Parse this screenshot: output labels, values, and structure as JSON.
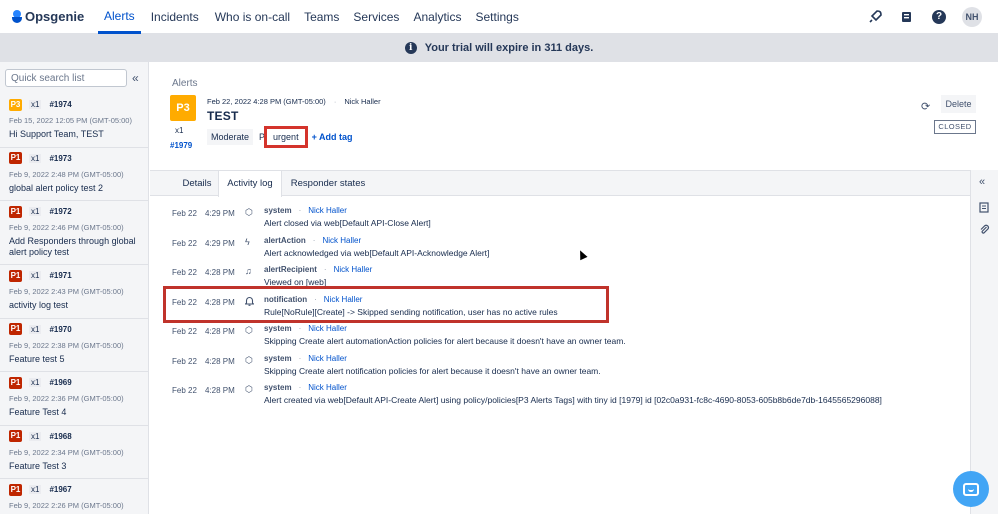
{
  "app": {
    "name": "Opsgenie"
  },
  "nav": {
    "items": [
      {
        "label": "Alerts",
        "active": true
      },
      {
        "label": "Incidents"
      },
      {
        "label": "Who is on-call"
      },
      {
        "label": "Teams"
      },
      {
        "label": "Services"
      },
      {
        "label": "Analytics"
      },
      {
        "label": "Settings"
      }
    ],
    "avatar_initials": "NH",
    "help_glyph": "?"
  },
  "banner": {
    "text": "Your trial will expire in 311 days.",
    "info_glyph": "i"
  },
  "sidebar": {
    "search_placeholder": "Quick search list",
    "collapse_glyph": "«",
    "alerts": [
      {
        "priority": "P3",
        "count": "x1",
        "tiny_id": "#1974",
        "date": "Feb 15, 2022 12:05 PM (GMT-05:00)",
        "message": "Hi Support Team, TEST"
      },
      {
        "priority": "P1",
        "count": "x1",
        "tiny_id": "#1973",
        "date": "Feb 9, 2022 2:48 PM (GMT-05:00)",
        "message": "global alert policy test 2"
      },
      {
        "priority": "P1",
        "count": "x1",
        "tiny_id": "#1972",
        "date": "Feb 9, 2022 2:46 PM (GMT-05:00)",
        "message": "Add Responders through global alert policy test"
      },
      {
        "priority": "P1",
        "count": "x1",
        "tiny_id": "#1971",
        "date": "Feb 9, 2022 2:43 PM (GMT-05:00)",
        "message": "activity log test"
      },
      {
        "priority": "P1",
        "count": "x1",
        "tiny_id": "#1970",
        "date": "Feb 9, 2022 2:38 PM (GMT-05:00)",
        "message": "Feature test 5"
      },
      {
        "priority": "P1",
        "count": "x1",
        "tiny_id": "#1969",
        "date": "Feb 9, 2022 2:36 PM (GMT-05:00)",
        "message": "Feature Test 4"
      },
      {
        "priority": "P1",
        "count": "x1",
        "tiny_id": "#1968",
        "date": "Feb 9, 2022 2:34 PM (GMT-05:00)",
        "message": "Feature Test 3"
      },
      {
        "priority": "P1",
        "count": "x1",
        "tiny_id": "#1967",
        "date": "Feb 9, 2022 2:26 PM (GMT-05:00)",
        "message": ""
      }
    ]
  },
  "detail": {
    "breadcrumb": "Alerts",
    "priority": "P3",
    "count": "x1",
    "tiny_id": "#1979",
    "created": "Feb 22, 2022 4:28 PM (GMT-05:00)",
    "separator": "·",
    "owner": "Nick Haller",
    "title": "TEST",
    "tags": {
      "moderate": "Moderate",
      "p_prefix": "P",
      "urgent": "urgent",
      "add_tag": "+ Add tag"
    },
    "refresh_glyph": "⟳",
    "delete_label": "Delete",
    "status": "CLOSED",
    "tabs": [
      {
        "label": "Details"
      },
      {
        "label": "Activity log",
        "active": true
      },
      {
        "label": "Responder states"
      }
    ]
  },
  "activity_log": [
    {
      "date": "Feb 22",
      "time": "4:29 PM",
      "icon": "cube-icon",
      "glyph": "⬡",
      "actor": "system",
      "user": "Nick Haller",
      "message": "Alert closed via web[Default API-Close Alert]"
    },
    {
      "date": "Feb 22",
      "time": "4:29 PM",
      "icon": "bolt-icon",
      "glyph": "ϟ",
      "actor": "alertAction",
      "user": "Nick Haller",
      "message": "Alert acknowledged via web[Default API-Acknowledge Alert]"
    },
    {
      "date": "Feb 22",
      "time": "4:28 PM",
      "icon": "recipient-icon",
      "glyph": "♫",
      "actor": "alertRecipient",
      "user": "Nick Haller",
      "message": "Viewed on [web]"
    },
    {
      "date": "Feb 22",
      "time": "4:28 PM",
      "icon": "bell-icon",
      "glyph": "🔔",
      "actor": "notification",
      "user": "Nick Haller",
      "message": "Rule[NoRule][Create] -> Skipped sending notification, user has no active rules"
    },
    {
      "date": "Feb 22",
      "time": "4:28 PM",
      "icon": "cube-icon",
      "glyph": "⬡",
      "actor": "system",
      "user": "Nick Haller",
      "message": "Skipping Create alert automationAction policies for alert because it doesn't have an owner team."
    },
    {
      "date": "Feb 22",
      "time": "4:28 PM",
      "icon": "cube-icon",
      "glyph": "⬡",
      "actor": "system",
      "user": "Nick Haller",
      "message": "Skipping Create alert notification policies for alert because it doesn't have an owner team."
    },
    {
      "date": "Feb 22",
      "time": "4:28 PM",
      "icon": "cube-icon",
      "glyph": "⬡",
      "actor": "system",
      "user": "Nick Haller",
      "message": "Alert created via web[Default API-Create Alert] using policy/policies[P3 Alerts Tags] with tiny id [1979] id [02c0a931-fc8c-4690-8053-605b8b6de7db-1645565296088]"
    }
  ],
  "colors": {
    "brand": "#0052cc",
    "p1": "#bf2600",
    "p3": "#ffab00",
    "highlight": "#c0332b"
  }
}
